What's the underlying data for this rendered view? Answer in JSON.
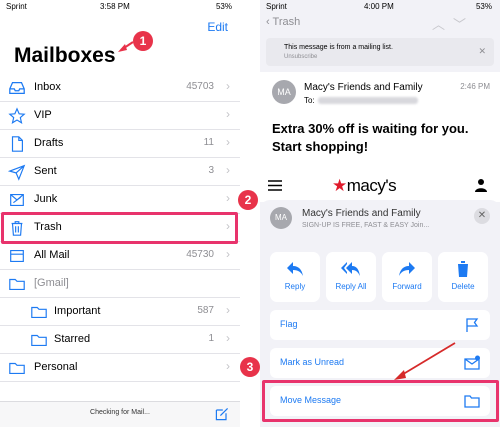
{
  "left": {
    "status": {
      "carrier": "Sprint",
      "time": "3:58 PM",
      "battery": "53%"
    },
    "edit_label": "Edit",
    "title": "Mailboxes",
    "mailboxes": [
      {
        "label": "Inbox",
        "count": "45703",
        "icon": "inbox-icon"
      },
      {
        "label": "VIP",
        "count": "",
        "icon": "star-icon"
      },
      {
        "label": "Drafts",
        "count": "11",
        "icon": "document-icon"
      },
      {
        "label": "Sent",
        "count": "3",
        "icon": "paper-plane-icon"
      },
      {
        "label": "Junk",
        "count": "",
        "icon": "junk-icon"
      },
      {
        "label": "Trash",
        "count": "",
        "icon": "trash-icon"
      },
      {
        "label": "All Mail",
        "count": "45730",
        "icon": "tray-icon"
      },
      {
        "label": "[Gmail]",
        "count": "",
        "icon": "folder-icon"
      },
      {
        "label": "Important",
        "count": "587",
        "icon": "folder-icon"
      },
      {
        "label": "Starred",
        "count": "1",
        "icon": "folder-icon"
      },
      {
        "label": "Personal",
        "count": "",
        "icon": "folder-icon"
      }
    ],
    "bottom_status": "Checking for Mail..."
  },
  "right": {
    "status": {
      "carrier": "Sprint",
      "time": "4:00 PM",
      "battery": "53%"
    },
    "back_label": "Trash",
    "mailing_list": {
      "text": "This message is from a mailing list.",
      "action": "Unsubscribe"
    },
    "message": {
      "avatar": "MA",
      "sender": "Macy's Friends and Family",
      "time": "2:46 PM",
      "to_label": "To:",
      "headline": "Extra 30% off is waiting for you. Start shopping!",
      "brand": "macy's"
    },
    "sheet": {
      "avatar": "MA",
      "sender": "Macy's Friends and Family",
      "preview": "SIGN-UP IS FREE, FAST & EASY Join...",
      "actions": [
        {
          "label": "Reply",
          "icon": "reply-icon"
        },
        {
          "label": "Reply All",
          "icon": "reply-all-icon"
        },
        {
          "label": "Forward",
          "icon": "forward-icon"
        },
        {
          "label": "Delete",
          "icon": "trash-icon"
        }
      ],
      "options": [
        {
          "label": "Flag",
          "icon": "flag-icon"
        },
        {
          "label": "Mark as Unread",
          "icon": "unread-envelope-icon"
        },
        {
          "label": "Move Message",
          "icon": "folder-icon"
        }
      ]
    }
  },
  "callouts": [
    "1",
    "2",
    "3"
  ],
  "colors": {
    "accent": "#1d7af2",
    "highlight": "#e8336c",
    "badge": "#e8334a",
    "brand_star": "#e01a2b"
  }
}
